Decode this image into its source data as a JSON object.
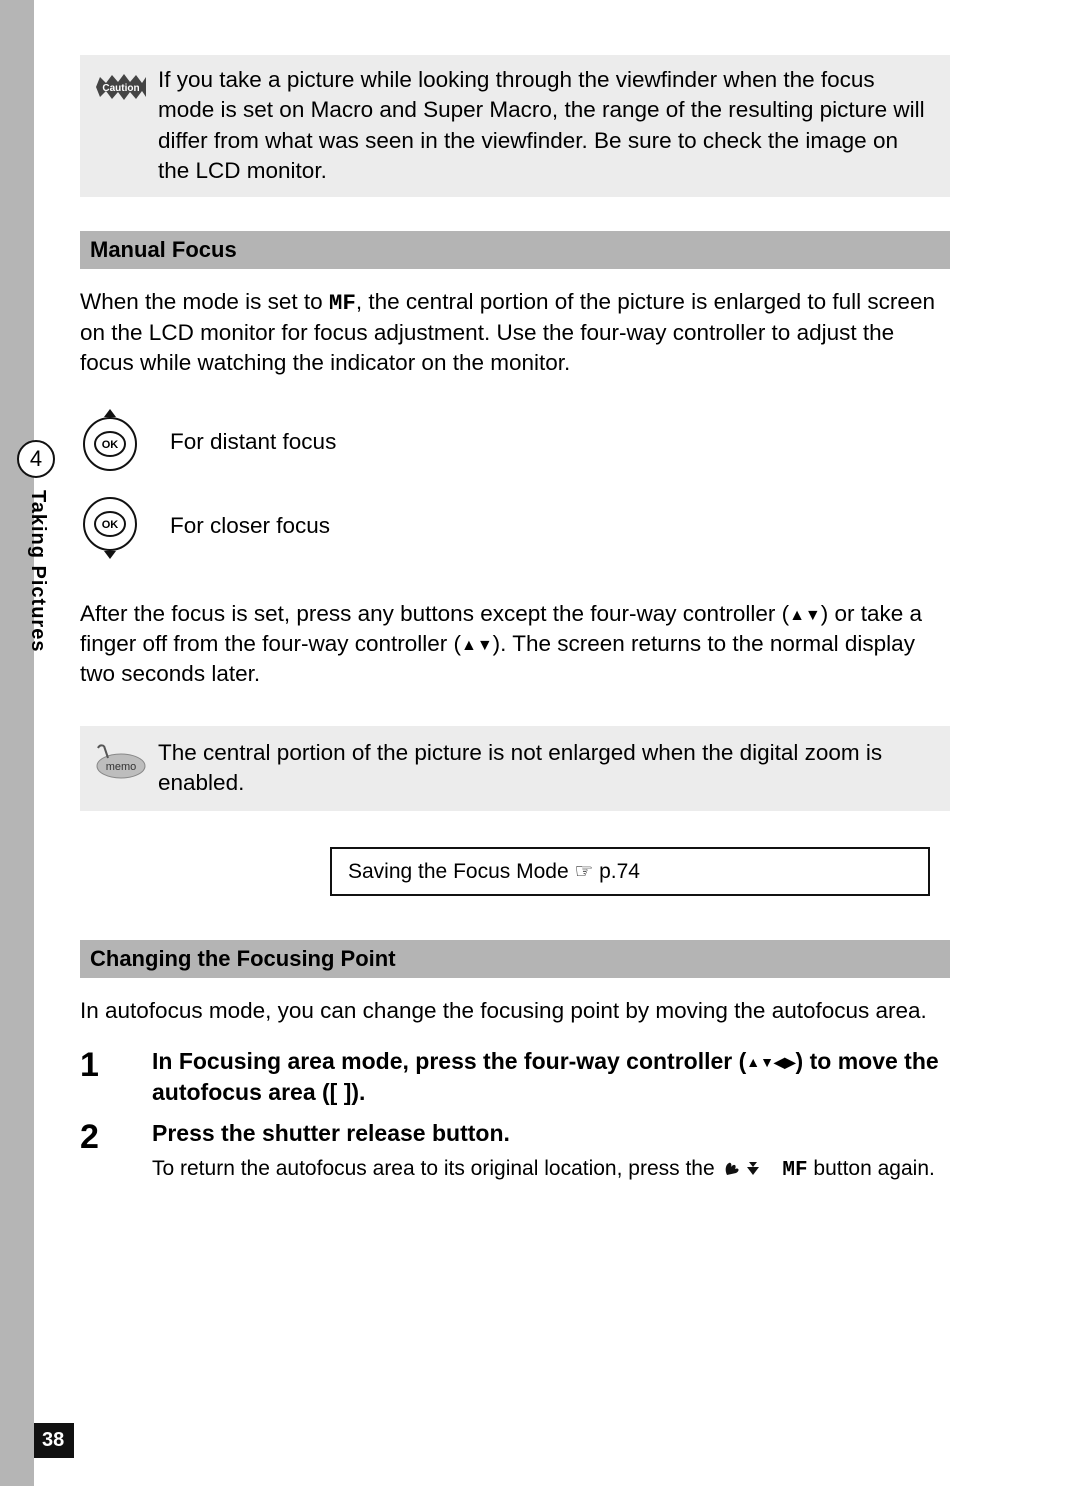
{
  "cautionBadge": "Caution",
  "cautionText": "If you take a picture while looking through the viewfinder when the focus mode is set on Macro and Super Macro, the range of the resulting picture will differ from what was seen in the viewfinder. Be sure to check the image on the LCD monitor.",
  "section1Title": "Manual Focus",
  "mfIntroPre": "When the mode is set to ",
  "mfMode": "MF",
  "mfIntroPost": ", the central portion of the picture is enlarged to full screen on the LCD monitor for focus adjustment. Use the four-way controller to adjust the focus while watching the indicator on the monitor.",
  "okUpLabel": "For distant focus",
  "okDownLabel": "For closer focus",
  "afterFocusA": "After the focus is set, press any buttons except the four-way controller (",
  "afterFocusArrows1": "▲▼",
  "afterFocusB": ") or take a finger off from the four-way controller (",
  "afterFocusArrows2": "▲▼",
  "afterFocusC": "). The screen returns to the normal display two seconds later.",
  "memoBadge": "memo",
  "memoText": "The central portion of the picture is not enlarged when the digital zoom is enabled.",
  "refBox": "Saving the Focus Mode ☞ p.74",
  "section2Title": "Changing the Focusing Point",
  "changeIntro": "In autofocus mode, you can change the focusing point by moving the autofocus area.",
  "step1Num": "1",
  "step1A": "In Focusing area mode, press the four-way controller (",
  "step1Arrows": "▲▼◀▶",
  "step1B": ") to move the autofocus area ([    ]).",
  "step2Num": "2",
  "step2Title": "Press the shutter release button.",
  "step2DetailA": "To return the autofocus area to its original location, press the ",
  "step2Icons": "✿ ▲ ",
  "step2MF": "MF",
  "step2DetailB": " button again.",
  "sideNumber": "4",
  "sideLabel": "Taking Pictures",
  "pageNumber": "38"
}
